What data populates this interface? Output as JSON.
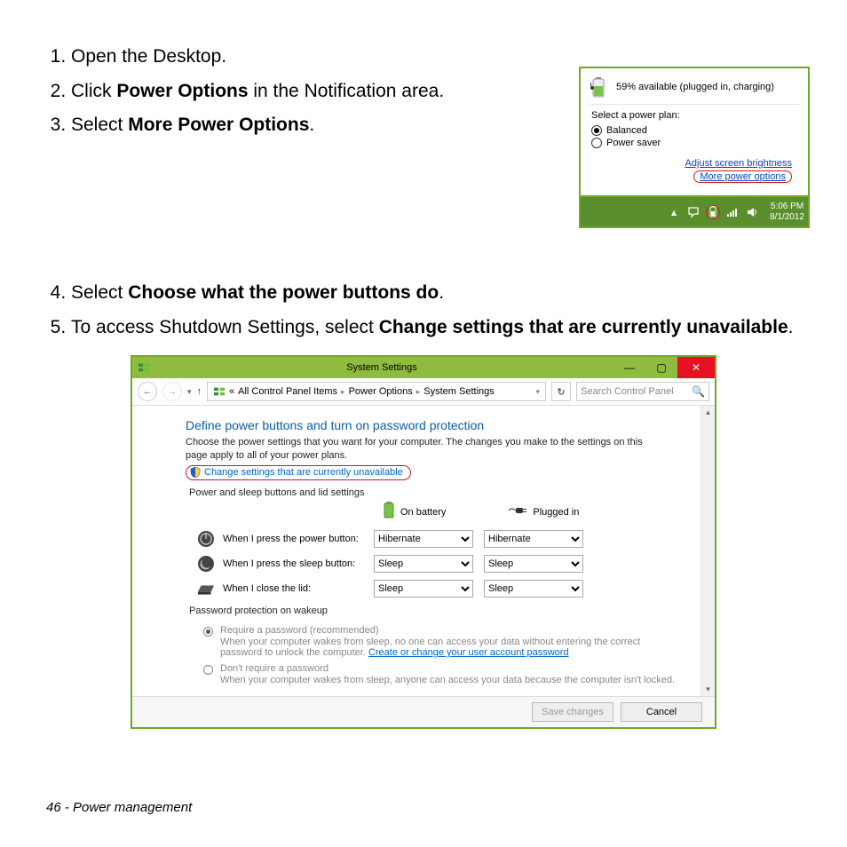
{
  "steps": {
    "s1": "Open the Desktop.",
    "s2a": "Click ",
    "s2b": "Power Options",
    "s2c": " in the Notification area.",
    "s3a": "Select ",
    "s3b": "More Power Options",
    "s3c": ".",
    "s4a": "Select ",
    "s4b": "Choose what the power buttons do",
    "s4c": ".",
    "s5a": "To access Shutdown Settings, select ",
    "s5b": "Change settings that are currently unavailable",
    "s5c": "."
  },
  "popup": {
    "status": "59% available (plugged in, charging)",
    "select_plan": "Select a power plan:",
    "plan_balanced": "Balanced",
    "plan_powersaver": "Power saver",
    "link_brightness": "Adjust screen brightness",
    "link_more": "More power options",
    "clock_time": "5:06 PM",
    "clock_date": "8/1/2012"
  },
  "syswin": {
    "title": "System Settings",
    "bc_prefix": "«",
    "bc1": "All Control Panel Items",
    "bc2": "Power Options",
    "bc3": "System Settings",
    "search_placeholder": "Search Control Panel",
    "heading": "Define power buttons and turn on password protection",
    "desc": "Choose the power settings that you want for your computer. The changes you make to the settings on this page apply to all of your power plans.",
    "change_link": "Change settings that are currently unavailable",
    "section1": "Power and sleep buttons and lid settings",
    "col_battery": "On battery",
    "col_plugged": "Plugged in",
    "row_power": "When I press the power button:",
    "row_sleep": "When I press the sleep button:",
    "row_lid": "When I close the lid:",
    "opt_hibernate": "Hibernate",
    "opt_sleep": "Sleep",
    "section2": "Password protection on wakeup",
    "pwd1_label": "Require a password (recommended)",
    "pwd1_desc_a": "When your computer wakes from sleep, no one can access your data without entering the correct password to unlock the computer. ",
    "pwd1_link": "Create or change your user account password",
    "pwd2_label": "Don't require a password",
    "pwd2_desc": "When your computer wakes from sleep, anyone can access your data because the computer isn't locked.",
    "btn_save": "Save changes",
    "btn_cancel": "Cancel"
  },
  "footer": "46 - Power management"
}
